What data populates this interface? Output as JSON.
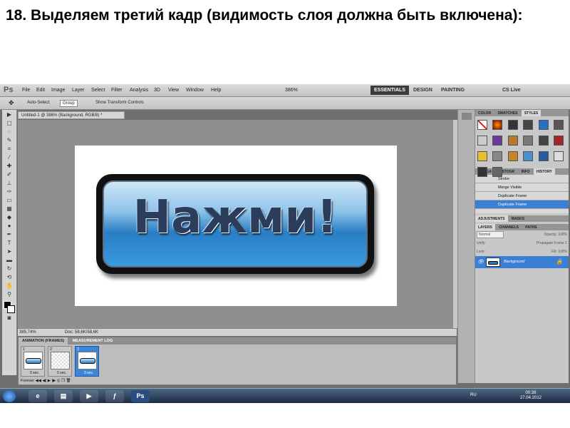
{
  "heading": "18. Выделяем третий кадр (видимость слоя должна быть включена):",
  "app": {
    "logo": "Ps"
  },
  "menu": [
    "File",
    "Edit",
    "Image",
    "Layer",
    "Select",
    "Filter",
    "Analysis",
    "3D",
    "View",
    "Window",
    "Help"
  ],
  "zoom_display": "386%",
  "workspaces": {
    "essentials": "ESSENTIALS",
    "design": "DESIGN",
    "painting": "PAINTING",
    "cslive": "CS Live"
  },
  "options": {
    "auto_select": "Auto-Select:",
    "group": "Group",
    "show_transform": "Show Transform Controls"
  },
  "document": {
    "tab_title": "Untitled-1 @ 386% (Background, RGB/8) *",
    "button_text": "Нажми!"
  },
  "status": {
    "zoom": "385,74%",
    "doc": "Doc: 58,6K/58,6K"
  },
  "animation": {
    "tab_frames": "ANIMATION (FRAMES)",
    "tab_log": "MEASUREMENT LOG",
    "frames": [
      {
        "num": "1",
        "delay": "0 sec."
      },
      {
        "num": "2",
        "delay": "0 sec."
      },
      {
        "num": "3",
        "delay": "0 sec."
      }
    ],
    "loop": "Forever"
  },
  "panels": {
    "color_tabs": [
      "COLOR",
      "SWATCHES",
      "STYLES"
    ],
    "history_tabs": [
      "NAVIGA",
      "HISTOGR",
      "INFO",
      "HISTORY"
    ],
    "history_items": [
      "Stroke",
      "Merge Visible",
      "Duplicate Frame",
      "Duplicate Frame"
    ],
    "adj_tabs": [
      "ADJUSTMENTS",
      "MASKS"
    ],
    "layers_tabs": [
      "LAYERS",
      "CHANNELS",
      "PATHS"
    ],
    "blend": "Normal",
    "opacity": "Opacity: 100%",
    "unify": "Unify:",
    "propagate": "Propagate Frame 1",
    "lock": "Lock:",
    "fill": "Fill: 100%",
    "layer_name": "Background"
  },
  "taskbar": {
    "lang": "RU",
    "time": "00:38",
    "date": "27.04.2012"
  }
}
